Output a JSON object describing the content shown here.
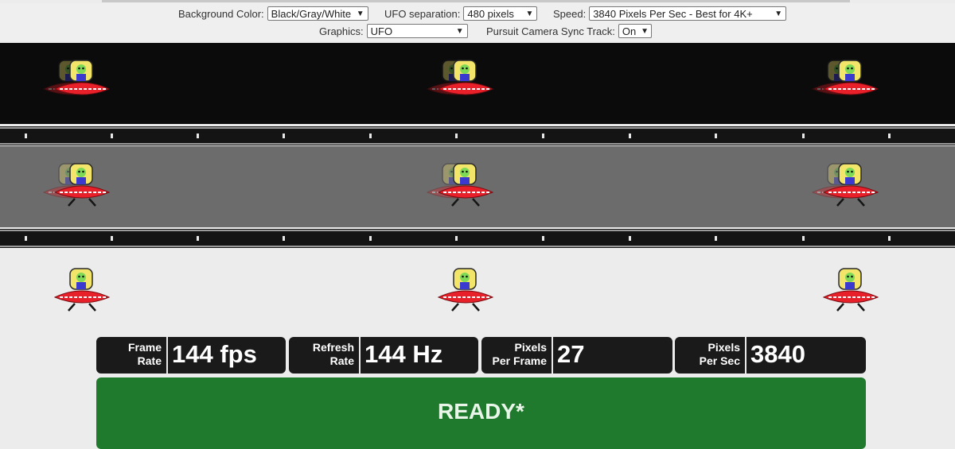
{
  "controls": {
    "background_color": {
      "label": "Background Color:",
      "value": "Black/Gray/White"
    },
    "ufo_separation": {
      "label": "UFO separation:",
      "value": "480 pixels"
    },
    "speed": {
      "label": "Speed:",
      "value": "3840 Pixels Per Sec - Best for 4K+"
    },
    "graphics": {
      "label": "Graphics:",
      "value": "UFO"
    },
    "pursuit_camera": {
      "label": "Pursuit Camera Sync Track:",
      "value": "On"
    }
  },
  "stats": [
    {
      "label_line1": "Frame",
      "label_line2": "Rate",
      "value": "144 fps"
    },
    {
      "label_line1": "Refresh",
      "label_line2": "Rate",
      "value": "144 Hz"
    },
    {
      "label_line1": "Pixels",
      "label_line2": "Per Frame",
      "value": "27"
    },
    {
      "label_line1": "Pixels",
      "label_line2": "Per Sec",
      "value": "3840"
    }
  ],
  "status": "READY*",
  "colors": {
    "ready_green": "#1f7a2e",
    "stat_box": "#1a1a1a",
    "ufo_red": "#e8202a",
    "alien_green": "#7ed957",
    "dome_yellow": "#f2e56a"
  }
}
